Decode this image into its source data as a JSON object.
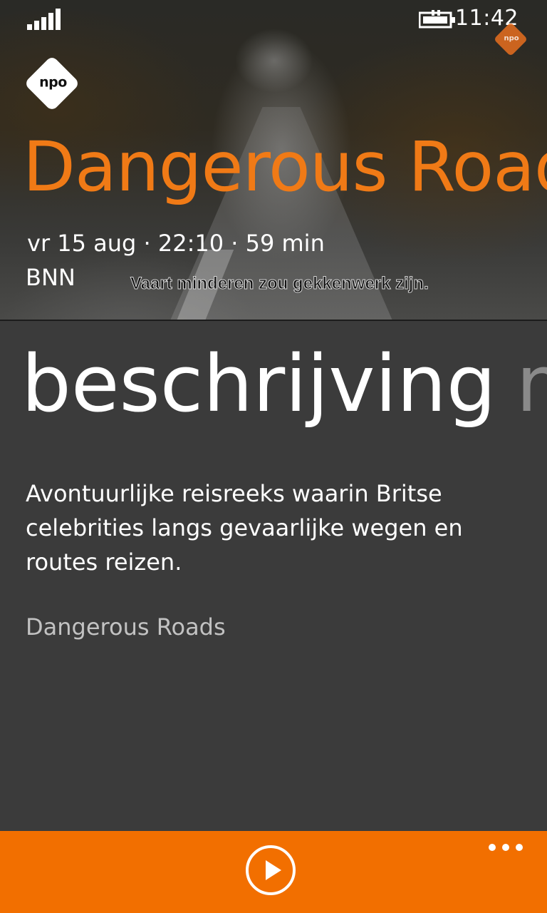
{
  "status_bar": {
    "time": "11:42",
    "signal_icon": "signal-bars-icon",
    "battery_icon": "battery-charging-icon"
  },
  "channel_bug": {
    "text": "npo"
  },
  "logo": {
    "text": "npo"
  },
  "program": {
    "title": "Dangerous Roads",
    "meta": "vr 15 aug · 22:10 · 59 min",
    "broadcaster": "BNN",
    "subtitle_caption": "Vaart minderen zou gekkenwerk zijn."
  },
  "pivot": {
    "active": "beschrijving",
    "next": "meer"
  },
  "description": {
    "text": "Avontuurlijke reisreeks waarin Britse celebrities langs gevaarlijke wegen en routes reizen.",
    "series_name": "Dangerous Roads"
  },
  "app_bar": {
    "play_icon": "play-circle-icon",
    "more_icon": "ellipsis-icon",
    "accent_color": "#f26f00"
  },
  "colors": {
    "title": "#f07a16",
    "background": "#3b3b3b"
  }
}
